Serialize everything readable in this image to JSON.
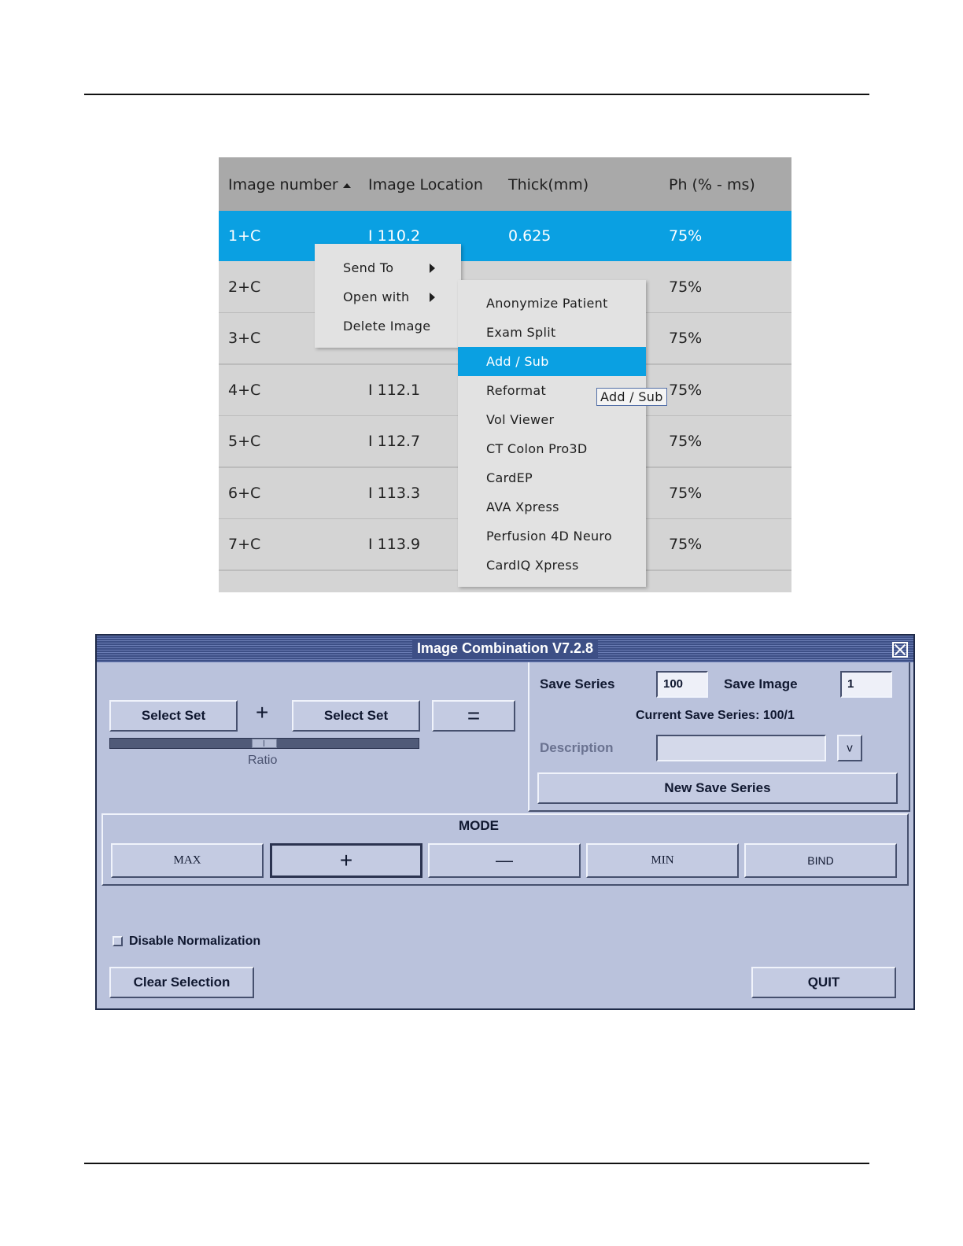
{
  "image_list": {
    "columns": [
      "Image number",
      "Image Location",
      "Thick(mm)",
      "Ph (% - ms)"
    ],
    "rows": [
      {
        "number": "1+C",
        "location": "I 110.2",
        "thick": "0.625",
        "ph": "75%",
        "selected": true
      },
      {
        "number": "2+C",
        "location": "",
        "thick": "",
        "ph": "75%"
      },
      {
        "number": "3+C",
        "location": "",
        "thick": "",
        "ph": "75%"
      },
      {
        "number": "4+C",
        "location": "I 112.1",
        "thick": "",
        "ph": "75%"
      },
      {
        "number": "5+C",
        "location": "I 112.7",
        "thick": "",
        "ph": "75%"
      },
      {
        "number": "6+C",
        "location": "I 113.3",
        "thick": "",
        "ph": "75%"
      },
      {
        "number": "7+C",
        "location": "I 113.9",
        "thick": "",
        "ph": "75%"
      }
    ],
    "context_menu": [
      "Send To",
      "Open with",
      "Delete Image"
    ],
    "submenu": [
      "Anonymize Patient",
      "Exam Split",
      "Add / Sub",
      "Reformat",
      "Vol Viewer",
      "CT Colon Pro3D",
      "CardEP",
      "AVA Xpress",
      "Perfusion 4D Neuro",
      "CardIQ Xpress"
    ],
    "submenu_highlighted": "Add / Sub",
    "tooltip": "Add / Sub",
    "colors": {
      "selection": "#0aa0e2",
      "header": "#a9a9a9",
      "row": "#d4d4d4",
      "menu": "#e2e2e2"
    }
  },
  "dialog": {
    "title": "Image Combination V7.2.8",
    "select_set_1": "Select Set",
    "plus_sign": "+",
    "select_set_2": "Select Set",
    "equals_sign": "=",
    "ratio_label": "Ratio",
    "save_series_label": "Save Series",
    "save_series_value": "100",
    "save_image_label": "Save Image",
    "save_image_value": "1",
    "current_save_series": "Current Save Series: 100/1",
    "description_label": "Description",
    "description_value": "",
    "dropdown_glyph": "v",
    "new_save_series": "New Save Series",
    "mode_label": "MODE",
    "mode_buttons": [
      "MAX",
      "+",
      "—",
      "MIN",
      "BIND"
    ],
    "disable_normalization": "Disable Normalization",
    "disable_normalization_checked": false,
    "clear_selection": "Clear Selection",
    "quit": "QUIT",
    "colors": {
      "background": "#bac2dc",
      "titlebar": "#3d4f86"
    }
  }
}
